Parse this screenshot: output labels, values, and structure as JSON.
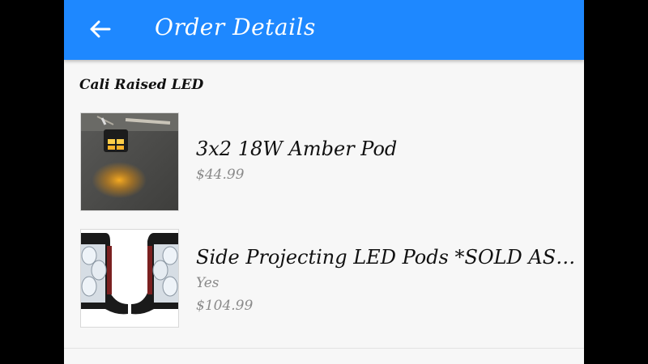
{
  "appbar": {
    "title": "Order Details",
    "back_icon": "arrow-left-icon",
    "color": "#1e88ff"
  },
  "store": {
    "name": "Cali Raised LED"
  },
  "items": [
    {
      "title": "3x2 18W Amber Pod",
      "option": "",
      "price": "$44.99",
      "thumb_icon": "amber-pod-photo"
    },
    {
      "title": "Side Projecting LED Pods *SOLD AS PAI...",
      "option": "Yes",
      "price": "$104.99",
      "thumb_icon": "side-projecting-pods-photo"
    }
  ]
}
